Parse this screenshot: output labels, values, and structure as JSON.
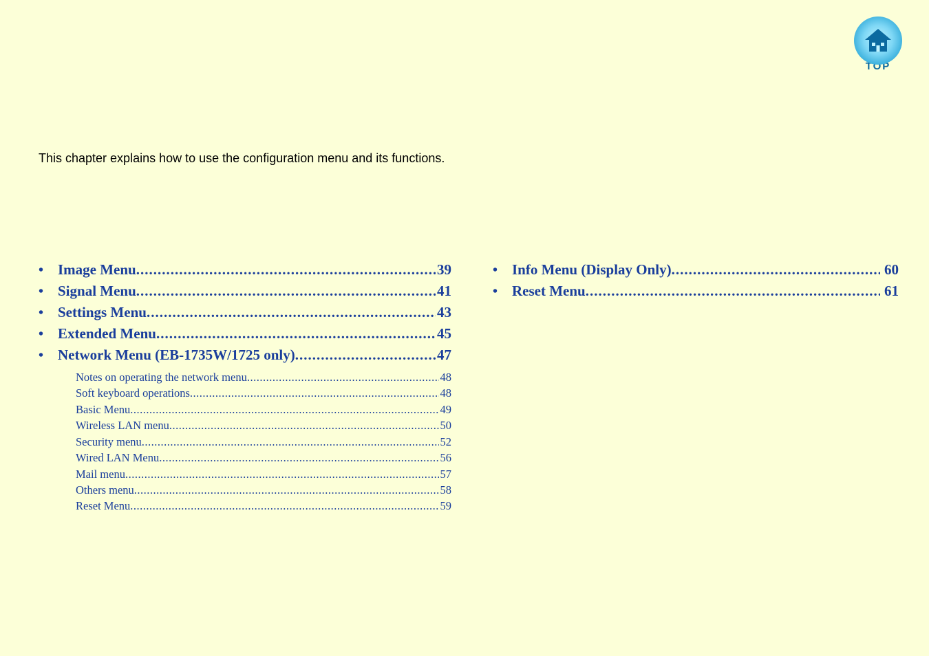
{
  "top_icon": {
    "label": "TOP",
    "name": "home-icon"
  },
  "intro": "This chapter explains how to use the configuration menu and its functions.",
  "link_color": "#1a3e9c",
  "background_color": "#fcffd8",
  "toc": {
    "left": {
      "items": [
        {
          "title": "Image Menu",
          "page": "39"
        },
        {
          "title": "Signal Menu",
          "page": "41"
        },
        {
          "title": "Settings Menu",
          "page": "43"
        },
        {
          "title": "Extended Menu",
          "page": "45"
        },
        {
          "title": "Network Menu (EB-1735W/1725 only)",
          "page": "47",
          "sub": [
            {
              "title": "Notes on operating the network menu",
              "page": "48"
            },
            {
              "title": "Soft keyboard operations",
              "page": "48"
            },
            {
              "title": "Basic Menu",
              "page": "49"
            },
            {
              "title": "Wireless LAN menu",
              "page": "50"
            },
            {
              "title": "Security menu",
              "page": "52"
            },
            {
              "title": "Wired LAN Menu",
              "page": "56"
            },
            {
              "title": "Mail menu",
              "page": "57"
            },
            {
              "title": "Others menu",
              "page": "58"
            },
            {
              "title": "Reset Menu",
              "page": "59"
            }
          ]
        }
      ]
    },
    "right": {
      "items": [
        {
          "title": "Info Menu (Display Only)",
          "page": "60"
        },
        {
          "title": "Reset Menu",
          "page": "61"
        }
      ]
    }
  }
}
